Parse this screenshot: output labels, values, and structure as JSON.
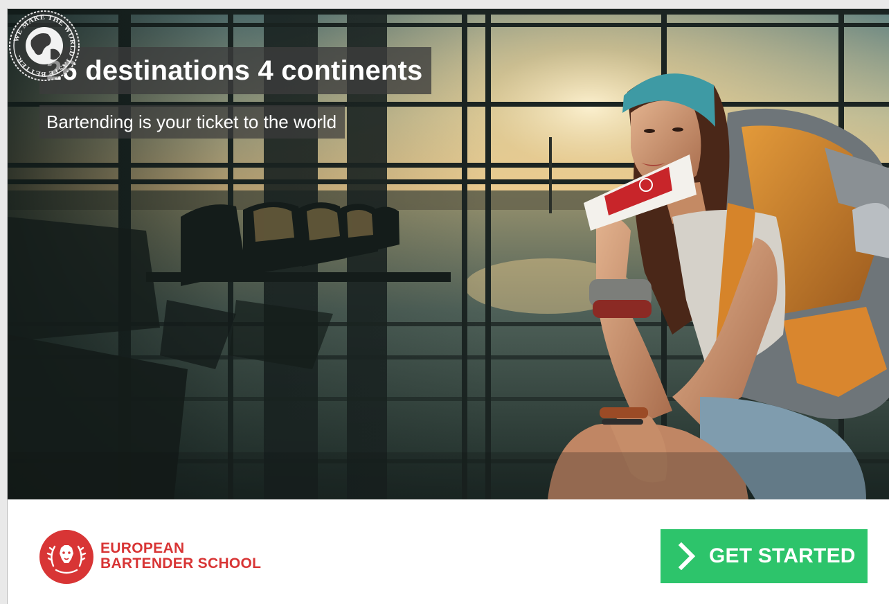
{
  "ad": {
    "headline": "26 destinations 4 continents",
    "subline": "Bartending is your ticket to the world",
    "seal_text": "WE MAKE THE WORLD TASTE BETTER.",
    "brand_line1": "EUROPEAN",
    "brand_line2": "BARTENDER SCHOOL",
    "cta_label": "GET STARTED"
  },
  "icons": {
    "seal": "globe-seal-icon",
    "logo": "lion-laurel-logo-icon",
    "cta": "chevron-right-icon"
  },
  "colors": {
    "brand_red": "#d83535",
    "cta_green": "#2dc46b",
    "caption_bg": "#3c3c3c"
  }
}
